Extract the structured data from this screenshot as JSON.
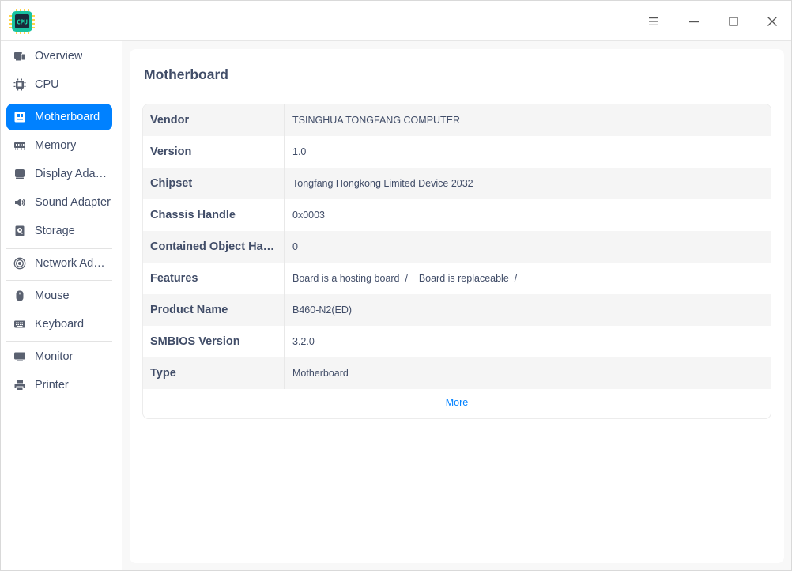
{
  "app": {
    "icon_text": "CPU"
  },
  "sidebar": {
    "items": [
      {
        "label": "Overview",
        "icon": "overview-icon"
      },
      {
        "label": "CPU",
        "icon": "cpu-icon"
      },
      {
        "label": "Motherboard",
        "icon": "motherboard-icon",
        "active": true
      },
      {
        "label": "Memory",
        "icon": "memory-icon"
      },
      {
        "label": "Display Adapter",
        "icon": "display-adapter-icon"
      },
      {
        "label": "Sound Adapter",
        "icon": "sound-icon"
      },
      {
        "label": "Storage",
        "icon": "storage-icon"
      },
      {
        "label": "Network Adapter",
        "icon": "network-icon"
      },
      {
        "label": "Mouse",
        "icon": "mouse-icon"
      },
      {
        "label": "Keyboard",
        "icon": "keyboard-icon"
      },
      {
        "label": "Monitor",
        "icon": "monitor-icon"
      },
      {
        "label": "Printer",
        "icon": "printer-icon"
      }
    ]
  },
  "main": {
    "title": "Motherboard",
    "rows": [
      {
        "key": "Vendor",
        "value": "TSINGHUA TONGFANG COMPUTER"
      },
      {
        "key": "Version",
        "value": "1.0"
      },
      {
        "key": "Chipset",
        "value": "Tongfang Hongkong Limited Device 2032"
      },
      {
        "key": "Chassis Handle",
        "value": "0x0003"
      },
      {
        "key": "Contained Object Handles",
        "value": "0"
      },
      {
        "key": "Features",
        "value": "Board is a hosting board  /    Board is replaceable  /"
      },
      {
        "key": "Product Name",
        "value": "B460-N2(ED)"
      },
      {
        "key": "SMBIOS Version",
        "value": "3.2.0"
      },
      {
        "key": "Type",
        "value": "Motherboard"
      }
    ],
    "more_label": "More"
  },
  "colors": {
    "accent": "#0081ff",
    "text": "#414d68",
    "app_icon_bg": "#19c3a0",
    "app_icon_chip": "#1a2a3a"
  }
}
